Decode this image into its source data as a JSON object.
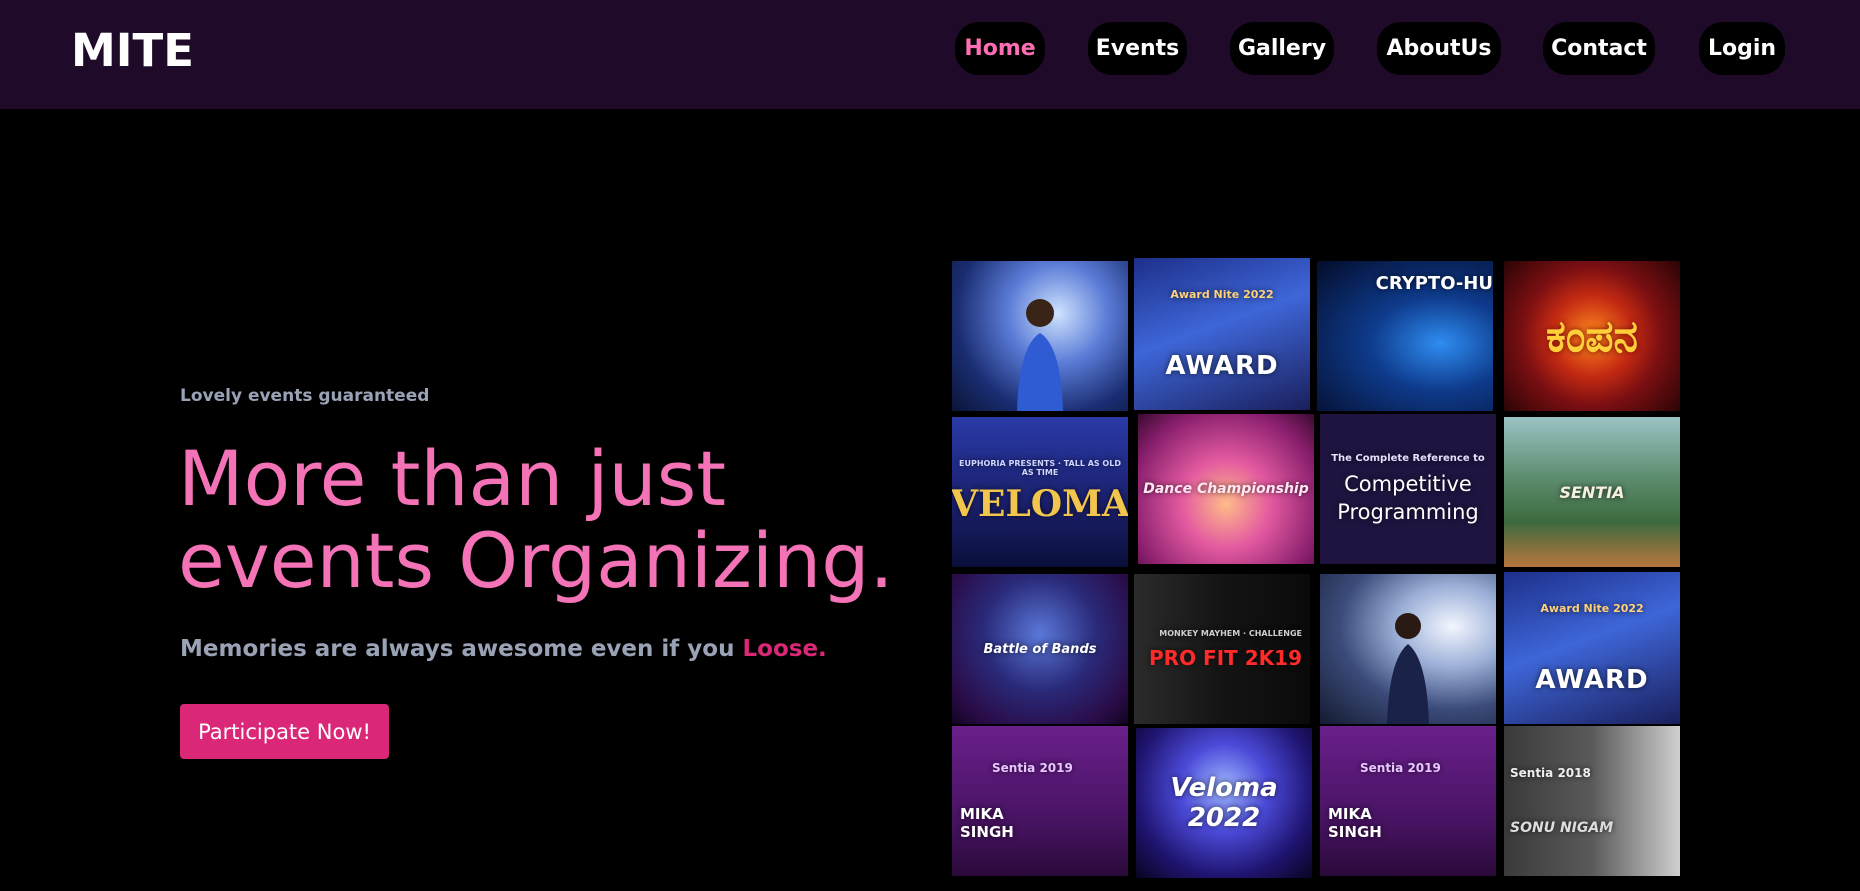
{
  "nav": {
    "logo": "MITE",
    "items": [
      {
        "label": "Home",
        "active": true
      },
      {
        "label": "Events",
        "active": false
      },
      {
        "label": "Gallery",
        "active": false
      },
      {
        "label": "AboutUs",
        "active": false
      },
      {
        "label": "Contact",
        "active": false
      },
      {
        "label": "Login",
        "active": false
      }
    ]
  },
  "hero": {
    "tagline": "Lovely events guaranteed",
    "headline_line1": "More than just",
    "headline_line2": "events Organizing.",
    "subline_prefix": "Memories are always awesome even if you",
    "subline_accent": "Loose.",
    "cta_label": "Participate Now!"
  },
  "gallery": {
    "tiles": [
      {
        "caption": "",
        "theme": "singer-blue"
      },
      {
        "caption": "AWARD",
        "sub": "Award Nite 2022",
        "theme": "award"
      },
      {
        "caption": "CRYPTO-HU",
        "theme": "crypto"
      },
      {
        "caption": "ಕಂಪನ",
        "theme": "kampana"
      },
      {
        "caption": "VELOMA",
        "sub": "EUPHORIA PRESENTS · TALL AS OLD AS TIME",
        "theme": "veloma-gold"
      },
      {
        "caption": "Dance Championship",
        "theme": "dance"
      },
      {
        "caption": "Competitive Programming",
        "sub": "The Complete Reference to",
        "theme": "programming"
      },
      {
        "caption": "SENTIA",
        "theme": "campus"
      },
      {
        "caption": "Battle of Bands",
        "theme": "bands"
      },
      {
        "caption": "PRO FIT 2K19",
        "sub": "MONKEY MAYHEM · CHALLENGE",
        "theme": "profit"
      },
      {
        "caption": "",
        "theme": "performer"
      },
      {
        "caption": "AWARD",
        "sub": "Award Nite 2022",
        "theme": "award"
      },
      {
        "caption": "MIKA SINGH",
        "sub": "Sentia 2019",
        "theme": "mika"
      },
      {
        "caption": "Veloma 2022",
        "theme": "veloma-blue"
      },
      {
        "caption": "MIKA SINGH",
        "sub": "Sentia 2019",
        "theme": "mika"
      },
      {
        "caption": "SONU NIGAM",
        "sub": "Sentia 2018",
        "theme": "sonu"
      }
    ]
  },
  "colors": {
    "nav_bg": "#1f0a2a",
    "accent_pink": "#f472b6",
    "accent_rose": "#db2777",
    "muted_text": "#9aa3b6"
  }
}
